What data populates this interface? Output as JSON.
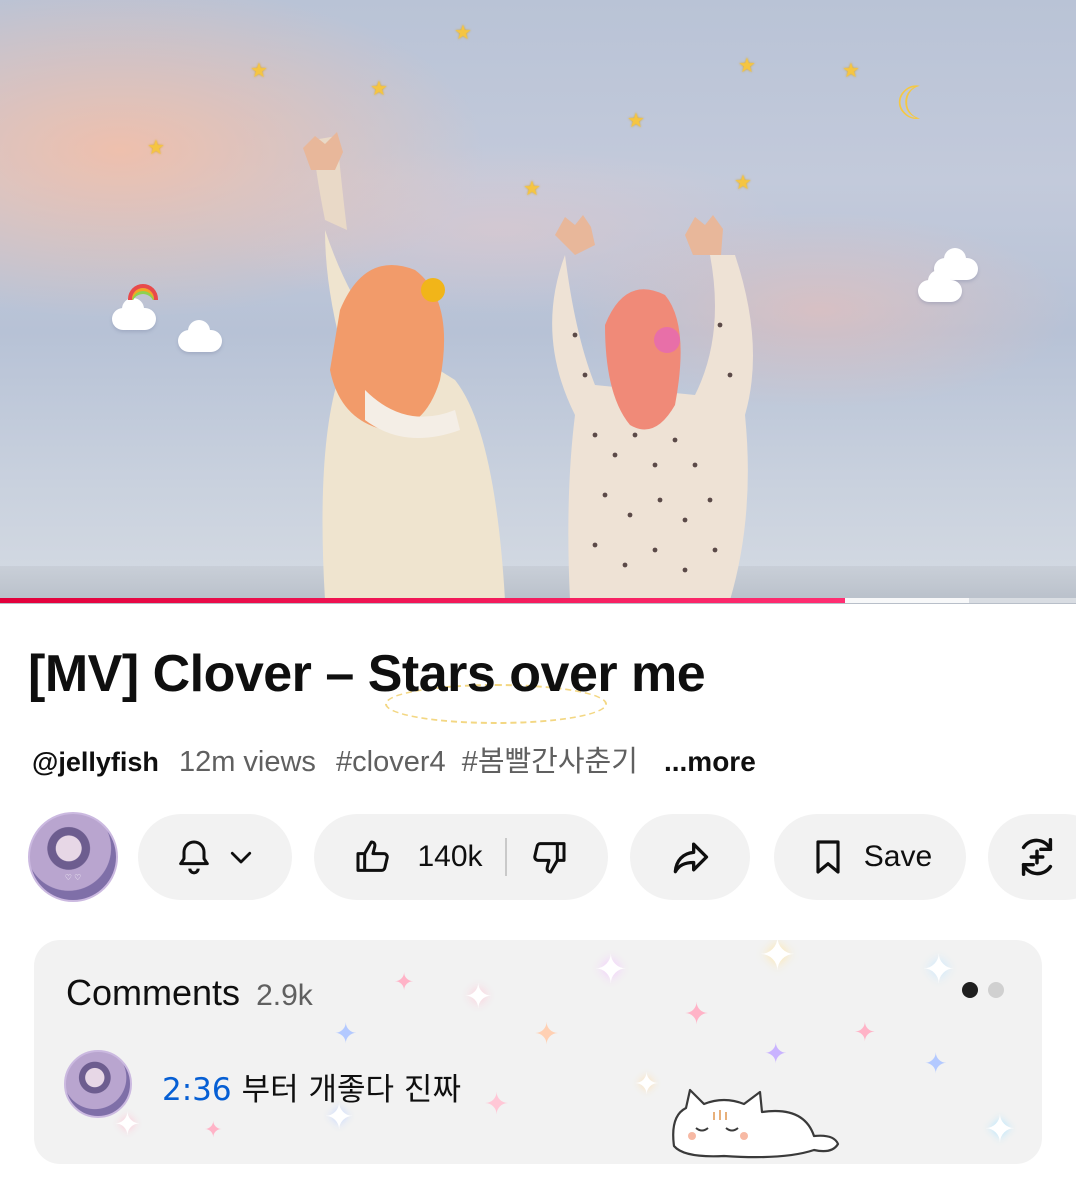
{
  "video": {
    "progress_fraction": 0.785,
    "buffered_fraction": 0.9,
    "accent_color": "#e2003b",
    "stickers": [
      "star-icon",
      "moon-icon",
      "cloud-icon",
      "rainbow-icon"
    ]
  },
  "title": "[MV] Clover – Stars over me",
  "meta": {
    "channel": "@jellyfish",
    "views": "12m views",
    "tags": [
      "#clover4",
      "#봄빨간사춘기"
    ],
    "more": "...more"
  },
  "actions": {
    "like_count": "140k",
    "save_label": "Save",
    "icons": [
      "bell-icon",
      "chevron-down-icon",
      "like-icon",
      "dislike-icon",
      "share-icon",
      "bookmark-icon",
      "remix-icon"
    ]
  },
  "comments": {
    "title": "Comments",
    "count": "2.9k",
    "top_comment": {
      "timestamp": "2:36",
      "text": "부터 개좋다 진짜"
    },
    "pager": {
      "pages": 2,
      "active": 1
    }
  }
}
